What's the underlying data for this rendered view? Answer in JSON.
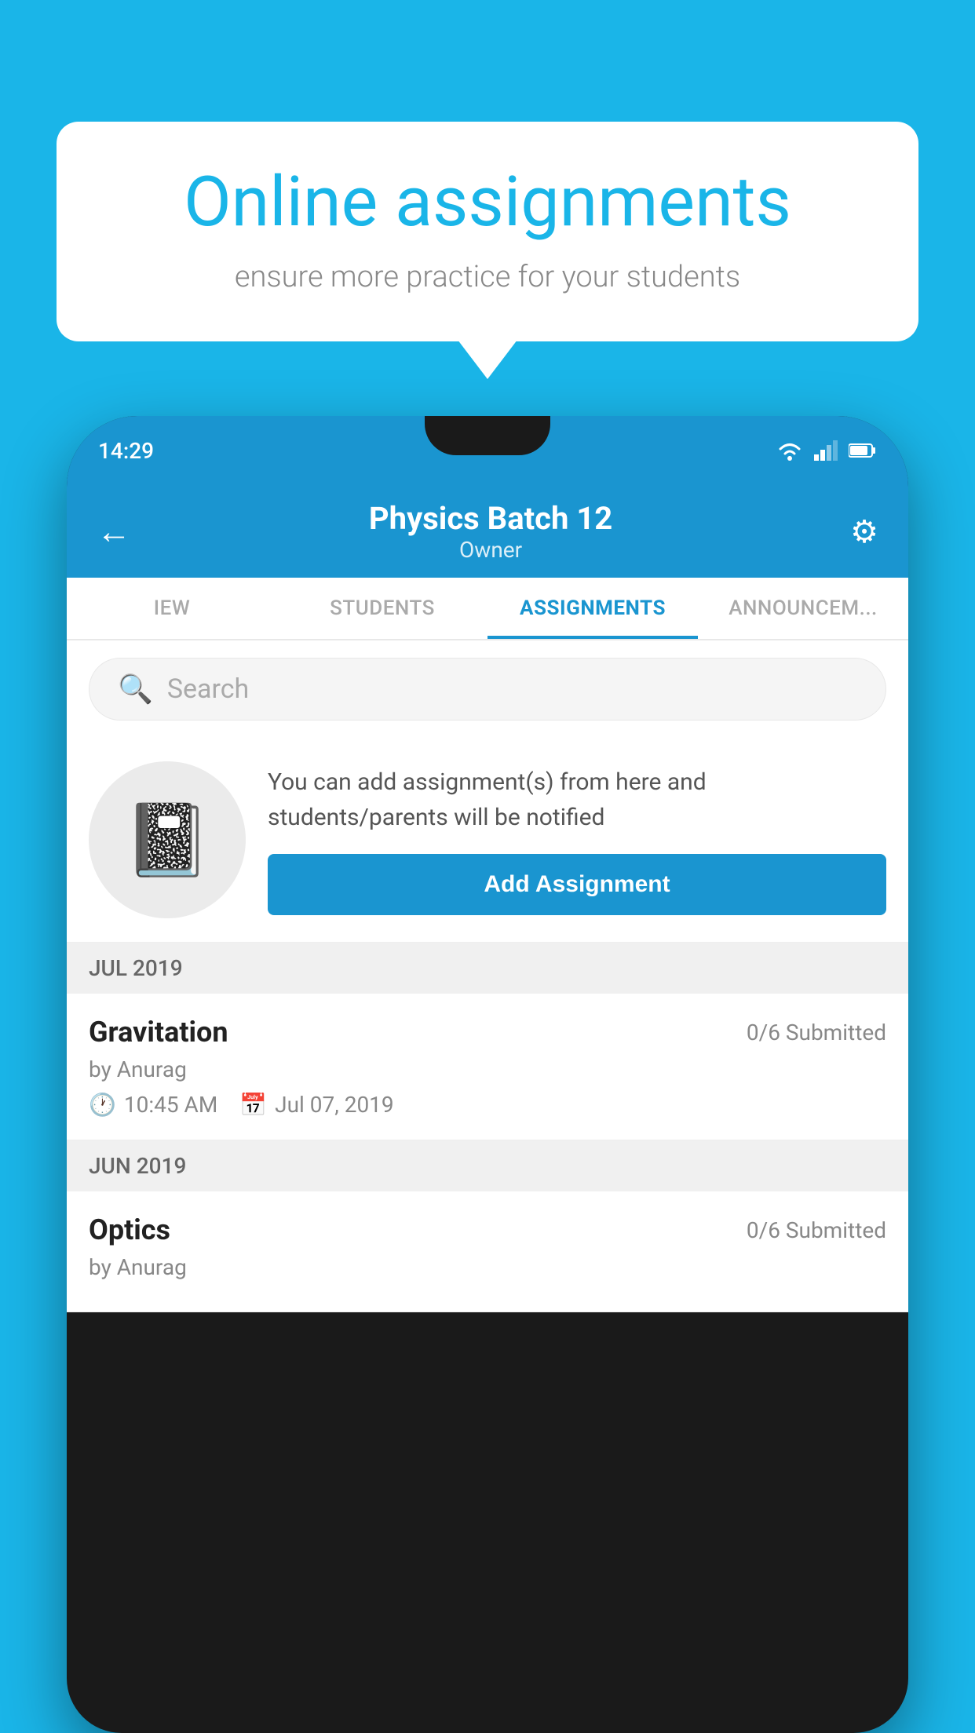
{
  "background": {
    "color": "#1ab5e8"
  },
  "speech_bubble": {
    "title": "Online assignments",
    "subtitle": "ensure more practice for your students"
  },
  "phone": {
    "status_bar": {
      "time": "14:29",
      "icons": [
        "wifi",
        "signal",
        "battery"
      ]
    },
    "header": {
      "title": "Physics Batch 12",
      "subtitle": "Owner",
      "back_label": "←",
      "settings_label": "⚙"
    },
    "tabs": [
      {
        "label": "IEW",
        "active": false
      },
      {
        "label": "STUDENTS",
        "active": false
      },
      {
        "label": "ASSIGNMENTS",
        "active": true
      },
      {
        "label": "ANNOUNCEM...",
        "active": false
      }
    ],
    "search": {
      "placeholder": "Search"
    },
    "promo": {
      "text": "You can add assignment(s) from here and students/parents will be notified",
      "button_label": "Add Assignment"
    },
    "sections": [
      {
        "label": "JUL 2019",
        "assignments": [
          {
            "title": "Gravitation",
            "submitted": "0/6 Submitted",
            "author": "by Anurag",
            "time": "10:45 AM",
            "date": "Jul 07, 2019"
          }
        ]
      },
      {
        "label": "JUN 2019",
        "assignments": [
          {
            "title": "Optics",
            "submitted": "0/6 Submitted",
            "author": "by Anurag",
            "time": "",
            "date": ""
          }
        ]
      }
    ]
  }
}
